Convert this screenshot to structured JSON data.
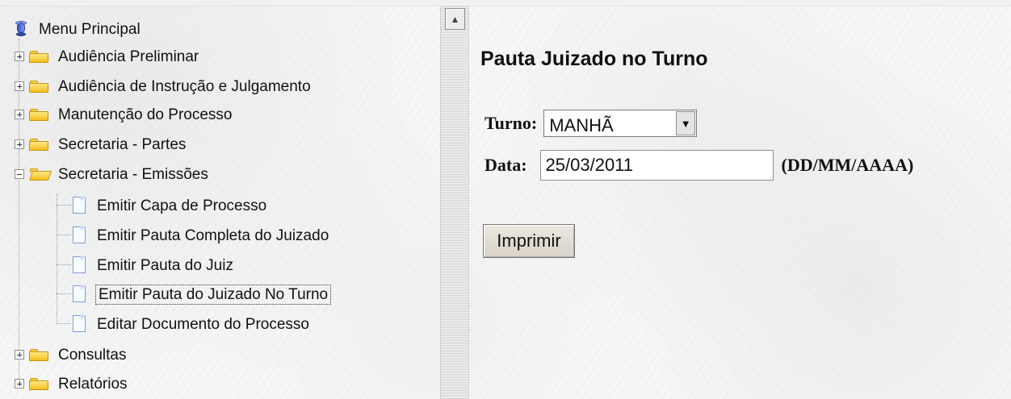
{
  "sidebar": {
    "root": {
      "label": "Menu Principal",
      "icon": "database-icon"
    },
    "items": [
      {
        "label": "Audiência Preliminar",
        "expanded": false
      },
      {
        "label": "Audiência de Instrução e Julgamento",
        "expanded": false
      },
      {
        "label": "Manutenção do Processo",
        "expanded": false
      },
      {
        "label": "Secretaria - Partes",
        "expanded": false
      },
      {
        "label": "Secretaria - Emissões",
        "expanded": true,
        "children": [
          {
            "label": "Emitir Capa de Processo"
          },
          {
            "label": "Emitir Pauta Completa do Juizado"
          },
          {
            "label": "Emitir Pauta do Juiz"
          },
          {
            "label": "Emitir Pauta do Juizado No Turno",
            "selected": true
          },
          {
            "label": "Editar Documento do Processo"
          }
        ]
      },
      {
        "label": "Consultas",
        "expanded": false
      },
      {
        "label": "Relatórios",
        "expanded": false
      }
    ]
  },
  "main": {
    "title": "Pauta Juizado no Turno",
    "turno_label": "Turno:",
    "turno_value": "MANHÃ",
    "data_label": "Data:",
    "data_value": "25/03/2011",
    "data_hint": "(DD/MM/AAAA)",
    "print_label": "Imprimir"
  },
  "colors": {
    "folder": "#F4BE1F",
    "document_border": "#7D9ED7",
    "database": "#3B55B8"
  }
}
